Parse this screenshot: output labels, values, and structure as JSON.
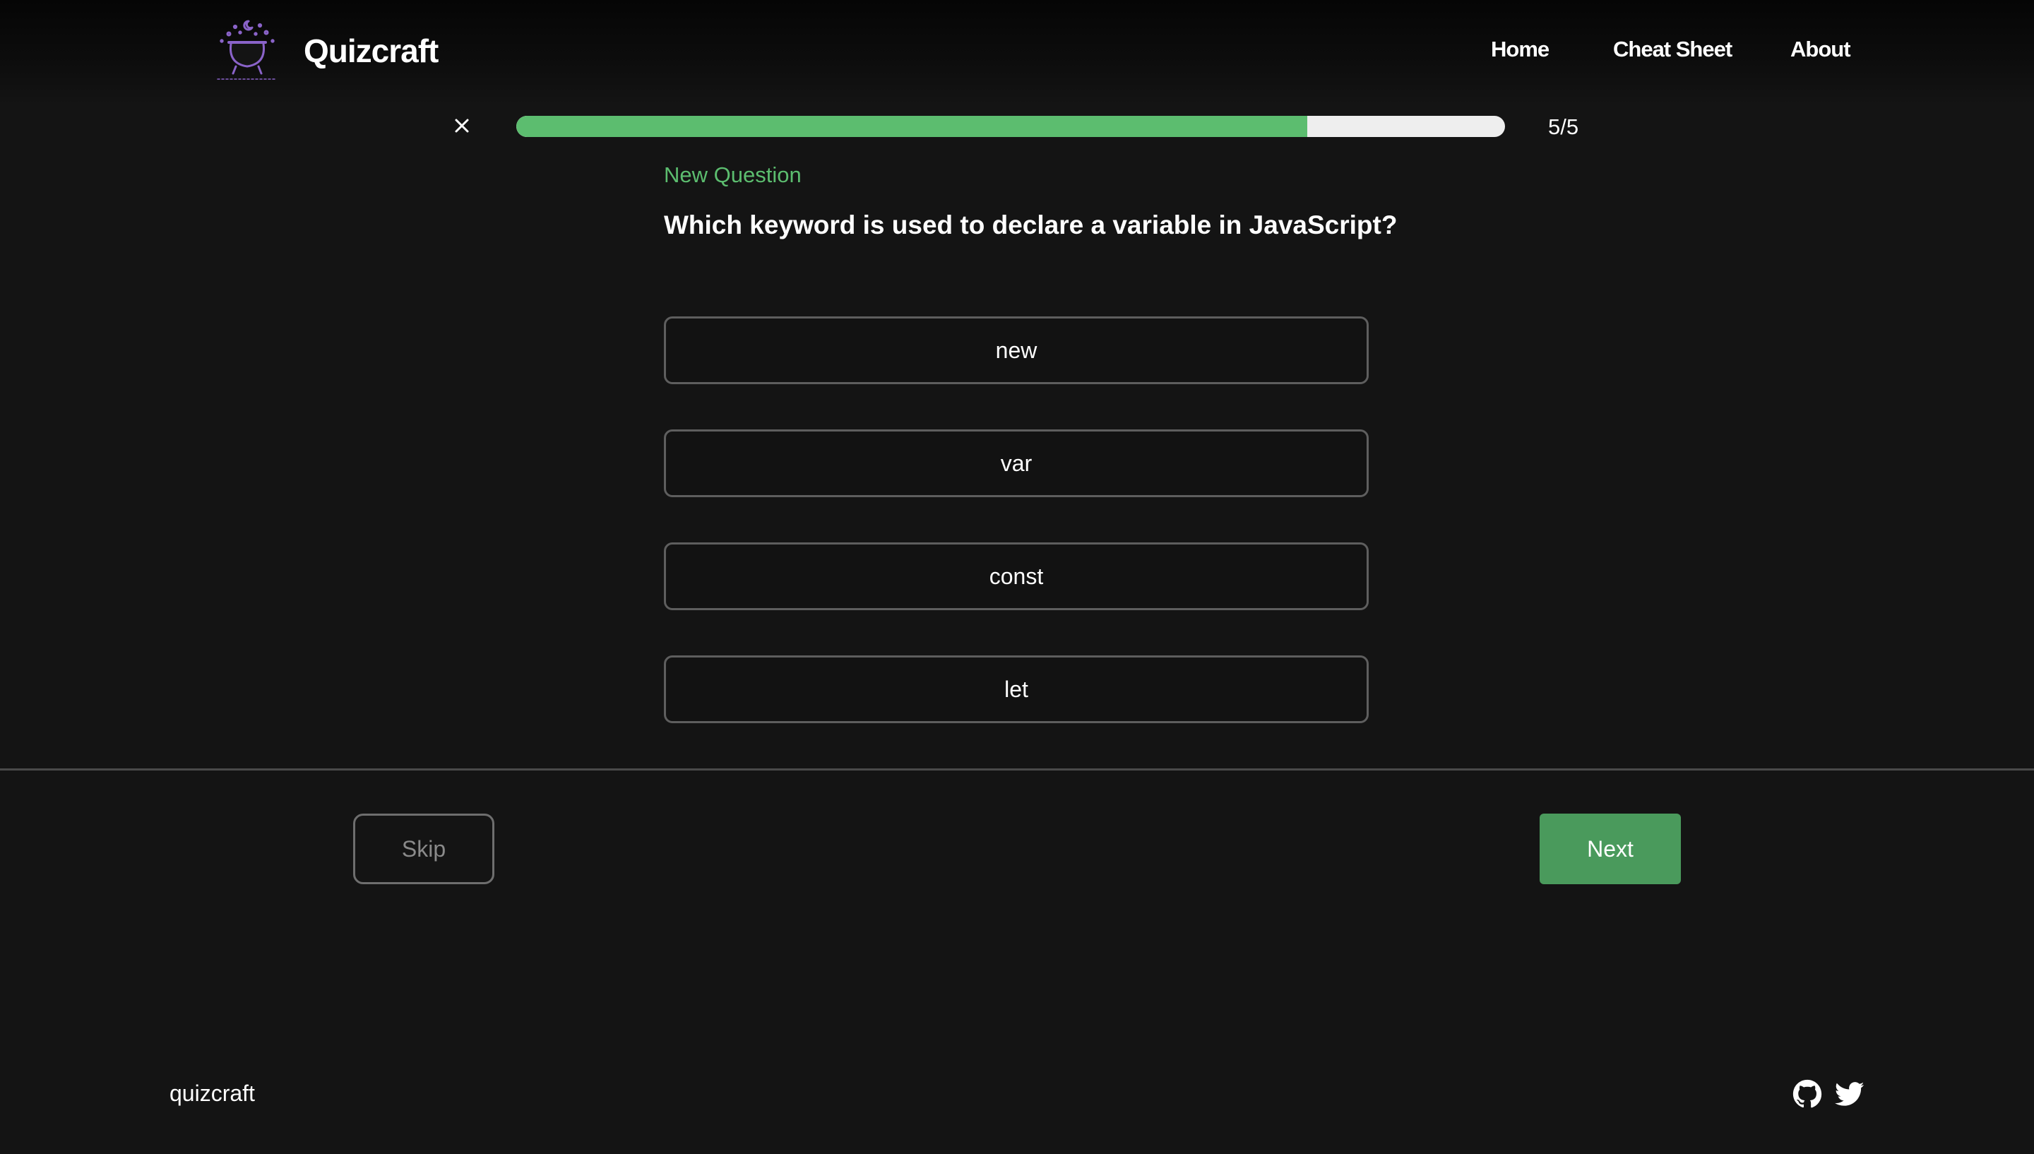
{
  "header": {
    "brand_name": "Quizcraft",
    "logo_icon": "cauldron-icon",
    "nav": [
      {
        "label": "Home"
      },
      {
        "label": "Cheat Sheet"
      },
      {
        "label": "About"
      }
    ]
  },
  "progress": {
    "close_icon": "close-icon",
    "fraction_complete": 0.8,
    "count_text": "5/5"
  },
  "question": {
    "tag": "New Question",
    "text": "Which keyword is used to declare a variable in JavaScript?",
    "options": [
      {
        "label": "new"
      },
      {
        "label": "var"
      },
      {
        "label": "const"
      },
      {
        "label": "let"
      }
    ]
  },
  "actions": {
    "skip_label": "Skip",
    "next_label": "Next"
  },
  "footer": {
    "brand": "quizcraft",
    "social_icons": [
      "github-icon",
      "twitter-icon"
    ]
  },
  "colors": {
    "background": "#141414",
    "accent_green": "#5cbd6f",
    "next_button": "#4a9a5c",
    "logo_purple": "#8a63c9"
  }
}
